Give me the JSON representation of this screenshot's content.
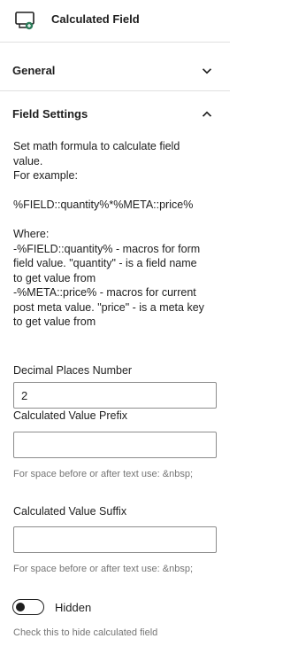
{
  "block": {
    "icon": "calculated-field-icon",
    "title": "Calculated Field"
  },
  "sections": {
    "general": {
      "title": "General",
      "icon": "chevron-down-icon"
    },
    "field_settings": {
      "title": "Field Settings",
      "icon": "chevron-up-icon"
    }
  },
  "help": {
    "line1": "Set math formula to calculate field",
    "line2": "value.",
    "line3": "For example:",
    "formula_example": "%FIELD::quantity%*%META::price%",
    "where_label": "Where:",
    "where1a": "-%FIELD::quantity% - macros for form",
    "where1b": "field value. \"quantity\" - is a field name",
    "where1c": "to get value from",
    "where2a": "-%META::price% - macros for current",
    "where2b": "post meta value. \"price\" - is a meta key",
    "where2c": "to get value from"
  },
  "fields": {
    "decimal_places": {
      "label": "Decimal Places Number",
      "value": "2"
    },
    "prefix": {
      "label": "Calculated Value Prefix",
      "value": "",
      "note": "For space before or after text use: &nbsp;"
    },
    "suffix": {
      "label": "Calculated Value Suffix",
      "value": "",
      "note": "For space before or after text use: &nbsp;"
    },
    "hidden": {
      "label": "Hidden",
      "checked": false,
      "note": "Check this to hide calculated field"
    }
  },
  "colors": {
    "text": "#1e1e1e",
    "muted": "#757575",
    "border": "#8c8c8c",
    "divider": "#e0e0e0",
    "icon_accent": "#2e7d5b"
  }
}
